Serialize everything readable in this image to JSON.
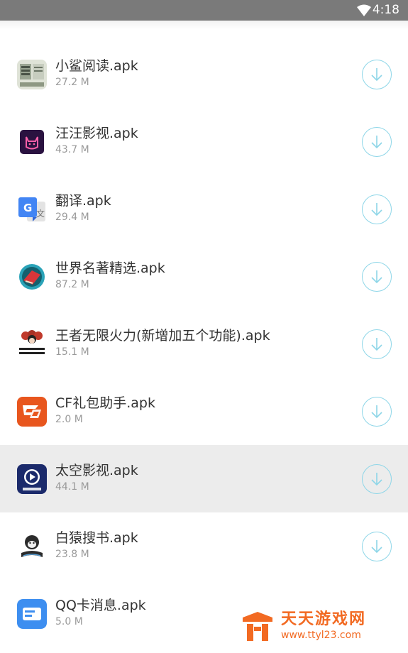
{
  "status_bar": {
    "time": "4:18",
    "wifi_icon": "wifi-icon"
  },
  "files": [
    {
      "name": "小鲨阅读.apk",
      "size": "27.2 M",
      "icon": "xiaosha-reader-icon",
      "highlighted": false
    },
    {
      "name": "汪汪影视.apk",
      "size": "43.7 M",
      "icon": "wangwang-video-icon",
      "highlighted": false
    },
    {
      "name": "翻译.apk",
      "size": "29.4 M",
      "icon": "google-translate-icon",
      "highlighted": false
    },
    {
      "name": "世界名著精选.apk",
      "size": "87.2 M",
      "icon": "world-classics-icon",
      "highlighted": false
    },
    {
      "name": "王者无限火力(新增加五个功能).apk",
      "size": "15.1 M",
      "icon": "wangzhe-meme-icon",
      "highlighted": false
    },
    {
      "name": "CF礼包助手.apk",
      "size": "2.0 M",
      "icon": "cf-gift-helper-icon",
      "highlighted": false
    },
    {
      "name": "太空影视.apk",
      "size": "44.1 M",
      "icon": "space-video-icon",
      "highlighted": true
    },
    {
      "name": "白猿搜书.apk",
      "size": "23.8 M",
      "icon": "white-ape-book-icon",
      "highlighted": false
    },
    {
      "name": "QQ卡消息.apk",
      "size": "5.0 M",
      "icon": "qq-card-message-icon",
      "highlighted": false
    }
  ],
  "download_icon": "download-arrow-icon",
  "watermark": {
    "title": "天天游戏网",
    "url": "www.ttyl23.com"
  },
  "colors": {
    "status_bar": "#7a7a7a",
    "highlight_row": "#ececec",
    "download_ring": "#8ed6e8",
    "watermark": "#f26a22"
  }
}
